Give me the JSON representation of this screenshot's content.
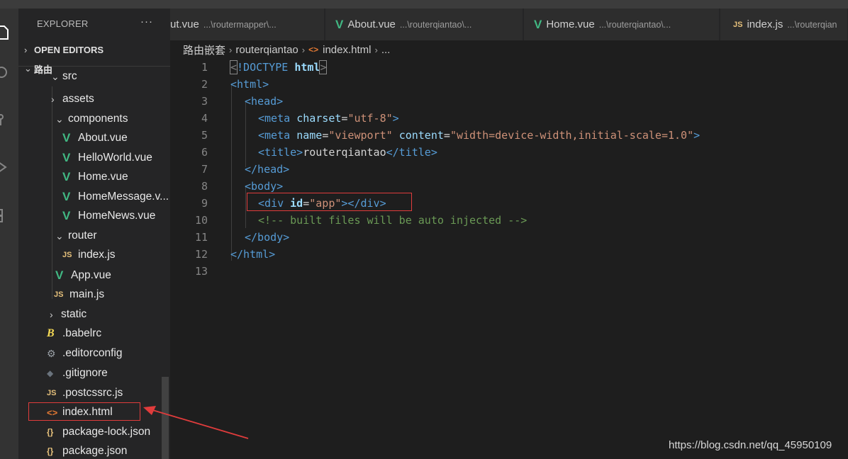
{
  "sidebar": {
    "title": "EXPLORER",
    "more": "···",
    "open_editors": "OPEN EDITORS",
    "folder": "路由",
    "tree": [
      {
        "label": "src",
        "kind": "folder-open",
        "level": 2
      },
      {
        "label": "assets",
        "kind": "folder-closed",
        "level": 3
      },
      {
        "label": "components",
        "kind": "folder-open",
        "level": 3
      },
      {
        "label": "About.vue",
        "kind": "vue",
        "level": 4
      },
      {
        "label": "HelloWorld.vue",
        "kind": "vue",
        "level": 4
      },
      {
        "label": "Home.vue",
        "kind": "vue",
        "level": 4
      },
      {
        "label": "HomeMessage.v...",
        "kind": "vue",
        "level": 4
      },
      {
        "label": "HomeNews.vue",
        "kind": "vue",
        "level": 4
      },
      {
        "label": "router",
        "kind": "folder-open",
        "level": 3
      },
      {
        "label": "index.js",
        "kind": "js",
        "level": 4
      },
      {
        "label": "App.vue",
        "kind": "vue",
        "level": 3
      },
      {
        "label": "main.js",
        "kind": "js",
        "level": 3
      },
      {
        "label": "static",
        "kind": "folder-closed",
        "level": 2
      },
      {
        "label": ".babelrc",
        "kind": "babel",
        "level": 2
      },
      {
        "label": ".editorconfig",
        "kind": "gear",
        "level": 2
      },
      {
        "label": ".gitignore",
        "kind": "git",
        "level": 2
      },
      {
        "label": ".postcssrc.js",
        "kind": "js",
        "level": 2
      },
      {
        "label": "index.html",
        "kind": "html",
        "level": 2
      },
      {
        "label": "package-lock.json",
        "kind": "json",
        "level": 2
      },
      {
        "label": "package.json",
        "kind": "json",
        "level": 2
      }
    ]
  },
  "tabs": [
    {
      "name": "ut.vue",
      "path": "...\\routermapper\\..."
    },
    {
      "name": "About.vue",
      "path": "...\\routerqiantao\\...",
      "icon": "vue"
    },
    {
      "name": "Home.vue",
      "path": "...\\routerqiantao\\...",
      "icon": "vue"
    },
    {
      "name": "index.js",
      "path": "...\\routerqian",
      "icon": "js"
    }
  ],
  "breadcrumb": {
    "folder": "路由嵌套",
    "sub": "routerqiantao",
    "file": "index.html",
    "tail": "..."
  },
  "icons": {
    "vue": "V",
    "js": "JS",
    "html": "<>",
    "json": "{}",
    "babel": "B",
    "gear": "⚙",
    "git": "◆",
    "chev_right": "›",
    "chev_down": "⌄"
  },
  "code": {
    "line_numbers": [
      "1",
      "2",
      "3",
      "4",
      "5",
      "6",
      "7",
      "8",
      "9",
      "10",
      "11",
      "12",
      "13"
    ],
    "l1": {
      "open": "<",
      "decl": "!DOCTYPE",
      "name": "html",
      "close": ">"
    },
    "l2": {
      "tag": "<html>"
    },
    "l3": {
      "tag": "<head>"
    },
    "l4": {
      "open": "<meta",
      "attr": "charset",
      "eq": "=",
      "val": "\"utf-8\"",
      "close": ">"
    },
    "l5": {
      "open": "<meta",
      "attr1": "name",
      "val1": "\"viewport\"",
      "attr2": "content",
      "val2": "\"width=device-width,initial-scale=1.0\"",
      "close": ">"
    },
    "l6": {
      "open": "<title>",
      "text": "routerqiantao",
      "close": "</title>"
    },
    "l7": {
      "tag": "</head>"
    },
    "l8": {
      "tag": "<body>"
    },
    "l9": {
      "open": "<div",
      "attr": "id",
      "val": "\"app\"",
      "close": "></div>"
    },
    "l10": {
      "comment": "<!-- built files will be auto injected -->"
    },
    "l11": {
      "tag": "</body>"
    },
    "l12": {
      "tag": "</html>"
    }
  },
  "watermark": "https://blog.csdn.net/qq_45950109",
  "colors": {
    "annotation_red": "#e03c3c",
    "vue_green": "#41b883",
    "tag_blue": "#569cd6",
    "attr_cyan": "#9cdcfe",
    "string_orange": "#ce9178",
    "comment_green": "#6a9955"
  }
}
